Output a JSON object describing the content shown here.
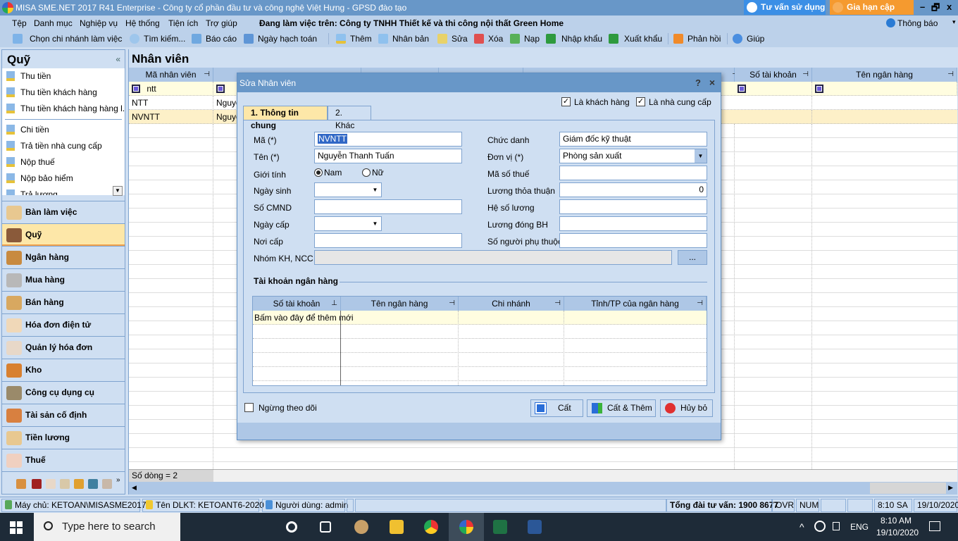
{
  "titlebar": {
    "title": "MISA SME.NET 2017 R41 Enterprise - Công ty cổ phần đầu tư và công nghệ Việt Hưng - GPSD đào tạo",
    "consult_button": "Tư vấn sử dụng",
    "renew_button": "Gia hạn cập nhật",
    "minimize": "–",
    "restore": "🗗",
    "close": "x"
  },
  "menubar": {
    "items": [
      "Tệp",
      "Danh mục",
      "Nghiệp vụ",
      "Hệ thống",
      "Tiện ích",
      "Trợ giúp"
    ],
    "working_on": "Đang làm việc trên:  Công ty TNHH Thiết kế và thi công nội thất Green Home",
    "notification": "Thông báo",
    "notification_arrow": "▾"
  },
  "toolbar": {
    "items": [
      {
        "label": "Chọn chi nhánh làm việc",
        "icon": "branch-icon"
      },
      {
        "label": "Tìm kiếm...",
        "icon": "search-icon"
      },
      {
        "label": "Báo cáo",
        "icon": "report-icon"
      },
      {
        "label": "Ngày hạch toán",
        "icon": "calendar-icon"
      },
      {
        "label": "Thêm",
        "icon": "add-icon"
      },
      {
        "label": "Nhân bản",
        "icon": "duplicate-icon"
      },
      {
        "label": "Sửa",
        "icon": "edit-icon"
      },
      {
        "label": "Xóa",
        "icon": "delete-icon"
      },
      {
        "label": "Nạp",
        "icon": "refresh-icon"
      },
      {
        "label": "Nhập khẩu",
        "icon": "excel-import-icon"
      },
      {
        "label": "Xuất khẩu",
        "icon": "excel-export-icon"
      },
      {
        "label": "Phản hồi",
        "icon": "mail-icon"
      },
      {
        "label": "Giúp",
        "icon": "help-icon"
      }
    ]
  },
  "left_panel": {
    "title": "Quỹ",
    "collapse": "«",
    "group1": [
      "Thu tiền",
      "Thu tiền khách hàng",
      "Thu tiền khách hàng hàng l..."
    ],
    "group2": [
      "Chi tiền",
      "Trả tiền nhà cung cấp",
      "Nộp thuế",
      "Nộp bảo hiểm",
      "Trả lương"
    ],
    "scroll_arrow": "▼",
    "modules": [
      {
        "label": "Bàn làm việc",
        "active": false
      },
      {
        "label": "Quỹ",
        "active": true
      },
      {
        "label": "Ngân hàng",
        "active": false
      },
      {
        "label": "Mua hàng",
        "active": false
      },
      {
        "label": "Bán hàng",
        "active": false
      },
      {
        "label": "Hóa đơn điện tử",
        "active": false
      },
      {
        "label": "Quản lý hóa đơn",
        "active": false
      },
      {
        "label": "Kho",
        "active": false
      },
      {
        "label": "Công cụ dụng cụ",
        "active": false
      },
      {
        "label": "Tài sản cố định",
        "active": false
      },
      {
        "label": "Tiền lương",
        "active": false
      },
      {
        "label": "Thuế",
        "active": false
      }
    ],
    "more": "»"
  },
  "main": {
    "title": "Nhân viên",
    "columns": [
      "Mã nhân viên",
      "",
      "",
      "",
      "",
      "",
      "Số tài khoản",
      "Tên ngân hàng"
    ],
    "filter_value": "ntt",
    "rows": [
      {
        "code": "NTT",
        "name": "Nguyễ"
      },
      {
        "code": "NVNTT",
        "name": "Nguyễ"
      }
    ],
    "row_count": "Số dòng = 2",
    "pin": "⊣"
  },
  "dialog": {
    "title": "Sửa Nhân viên",
    "help": "?",
    "close": "×",
    "is_customer_label": "Là khách hàng",
    "is_customer": true,
    "is_supplier_label": "Là nhà cung cấp",
    "is_supplier": true,
    "tabs": [
      "1. Thông tin chung",
      "2. Khác"
    ],
    "fields": {
      "code_label": "Mã (*)",
      "code": "NVNTT",
      "name_label": "Tên (*)",
      "name": "Nguyễn Thanh Tuấn",
      "gender_label": "Giới tính",
      "gender_male": "Nam",
      "gender_female": "Nữ",
      "gender": "Nam",
      "dob_label": "Ngày sinh",
      "dob": "",
      "id_label": "Số CMND",
      "id": "",
      "issue_date_label": "Ngày cấp",
      "issue_date": "",
      "issue_place_label": "Nơi cấp",
      "issue_place": "",
      "group_label": "Nhóm KH, NCC",
      "group": "",
      "group_button": "...",
      "position_label": "Chức danh",
      "position": "Giám đốc kỹ thuật",
      "unit_label": "Đơn vị (*)",
      "unit": "Phòng sản xuất",
      "tax_label": "Mã số thuế",
      "tax": "",
      "agreed_salary_label": "Lương thỏa thuận",
      "agreed_salary": "0",
      "coefficient_label": "Hệ số lương",
      "coefficient": "",
      "insurance_salary_label": "Lương đóng BH",
      "insurance_salary": "",
      "dependents_label": "Số người phụ thuộc",
      "dependents": ""
    },
    "bank_section": "Tài khoản ngân hàng",
    "bank_columns": [
      "Số tài khoản",
      "Tên ngân hàng",
      "Chi nhánh",
      "Tỉnh/TP của ngân hàng"
    ],
    "bank_add_hint": "Bấm vào đây để thêm mới",
    "stop_tracking_label": "Ngừng theo dõi",
    "stop_tracking": false,
    "buttons": {
      "save": "Cất",
      "save_add": "Cất & Thêm",
      "cancel": "Hủy bỏ"
    }
  },
  "statusbar": {
    "server": "Máy chủ: KETOAN\\MISASME2017",
    "database": "Tên DLKT: KETOANT6-2020",
    "user": "Người dùng: admin",
    "hotline": "Tổng đài tư vấn: 1900 8677",
    "ovr": "OVR",
    "num": "NUM",
    "time": "8:10 SA",
    "date": "19/10/2020"
  },
  "taskbar": {
    "search_placeholder": "Type here to search",
    "apps": [
      "cortana",
      "task-view",
      "paint",
      "file-explorer",
      "chrome",
      "misa",
      "excel",
      "word"
    ],
    "language": "ENG",
    "time": "8:10 AM",
    "date": "19/10/2020",
    "tray_up": "^"
  }
}
